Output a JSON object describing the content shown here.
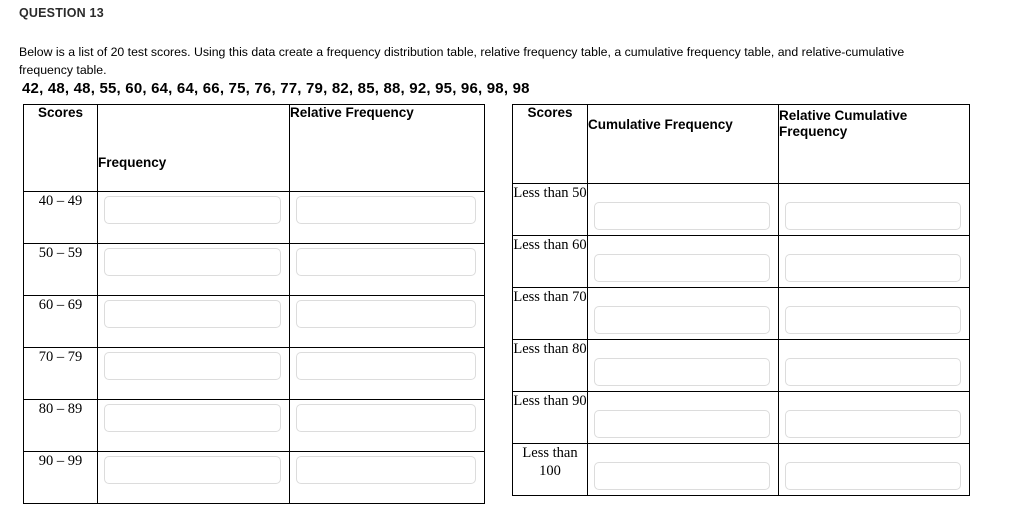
{
  "question": {
    "label": "QUESTION 13",
    "prompt": "Below is a list of 20 test scores. Using this data create a frequency distribution table, relative frequency table, a cumulative frequency table, and relative-cumulative frequency table.",
    "scores_line": "42, 48, 48, 55, 60, 64, 64, 66, 75, 76, 77, 79, 82, 85, 88, 92, 95, 96, 98, 98"
  },
  "colors": {
    "page_background": "#ffffff",
    "text": "#000000",
    "heading": "#2b2b2b",
    "table_border": "#000000",
    "input_border": "#dcdcdc",
    "input_background": "#ffffff"
  },
  "frequency_table": {
    "headers": {
      "scores": "Scores",
      "frequency": "Frequency",
      "relative_frequency": "Relative Frequency"
    },
    "rows": [
      {
        "label": "40 – 49",
        "frequency_value": "",
        "relative_frequency_value": ""
      },
      {
        "label": "50 – 59",
        "frequency_value": "",
        "relative_frequency_value": ""
      },
      {
        "label": "60 – 69",
        "frequency_value": "",
        "relative_frequency_value": ""
      },
      {
        "label": "70 – 79",
        "frequency_value": "",
        "relative_frequency_value": ""
      },
      {
        "label": "80 – 89",
        "frequency_value": "",
        "relative_frequency_value": ""
      },
      {
        "label": "90 – 99",
        "frequency_value": "",
        "relative_frequency_value": ""
      }
    ]
  },
  "cumulative_table": {
    "headers": {
      "scores": "Scores",
      "cumulative_frequency": "Cumulative Frequency",
      "relative_cumulative_frequency": "Relative Cumulative Frequency"
    },
    "rows": [
      {
        "label": "Less than 50",
        "cumulative_value": "",
        "relative_cumulative_value": ""
      },
      {
        "label": "Less than 60",
        "cumulative_value": "",
        "relative_cumulative_value": ""
      },
      {
        "label": "Less than 70",
        "cumulative_value": "",
        "relative_cumulative_value": ""
      },
      {
        "label": "Less than 80",
        "cumulative_value": "",
        "relative_cumulative_value": ""
      },
      {
        "label": "Less than 90",
        "cumulative_value": "",
        "relative_cumulative_value": ""
      },
      {
        "label": "Less than 100",
        "cumulative_value": "",
        "relative_cumulative_value": ""
      }
    ]
  }
}
